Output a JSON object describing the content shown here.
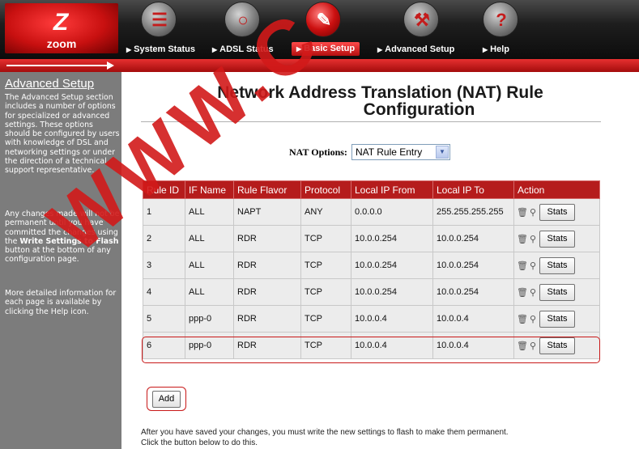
{
  "header": {
    "logo_mark": "Z",
    "logo_text": "zoom",
    "nav": [
      {
        "label": "System Status",
        "icon": "document-icon",
        "glyph": "☰"
      },
      {
        "label": "ADSL Status",
        "icon": "magnifier-icon",
        "glyph": "○"
      },
      {
        "label": "Basic Setup",
        "icon": "pencil-icon",
        "glyph": "✎"
      },
      {
        "label": "Advanced Setup",
        "icon": "wrench-icon",
        "glyph": "⚒"
      },
      {
        "label": "Help",
        "icon": "help-icon",
        "glyph": "?"
      }
    ],
    "active_nav": "Basic Setup"
  },
  "sidebar": {
    "title": "Advanced Setup",
    "para1": "The Advanced Setup section includes a number of options for specialized or advanced settings. These options should be configured by users with knowledge of DSL and networking settings or under the direction of a technical support representative.",
    "para2_a": "Any changes made will not be permanent until you have committed the changes using the ",
    "para2_bold": "Write Settings to Flash",
    "para2_b": " button at the bottom of any configuration page.",
    "para3": "More detailed information for each page is available by clicking the Help icon."
  },
  "main": {
    "title_line1": "Network Address Translation (NAT) Rule",
    "title_line2": "Configuration",
    "nat_options_label": "NAT Options:",
    "nat_options_value": "NAT Rule Entry",
    "table": {
      "headers": [
        "Rule ID",
        "IF Name",
        "Rule Flavor",
        "Protocol",
        "Local IP From",
        "Local IP To",
        "Action"
      ],
      "rows": [
        [
          "1",
          "ALL",
          "NAPT",
          "ANY",
          "0.0.0.0",
          "255.255.255.255"
        ],
        [
          "2",
          "ALL",
          "RDR",
          "TCP",
          "10.0.0.254",
          "10.0.0.254"
        ],
        [
          "3",
          "ALL",
          "RDR",
          "TCP",
          "10.0.0.254",
          "10.0.0.254"
        ],
        [
          "4",
          "ALL",
          "RDR",
          "TCP",
          "10.0.0.254",
          "10.0.0.254"
        ],
        [
          "5",
          "ppp-0",
          "RDR",
          "TCP",
          "10.0.0.4",
          "10.0.0.4"
        ],
        [
          "6",
          "ppp-0",
          "RDR",
          "TCP",
          "10.0.0.4",
          "10.0.0.4"
        ]
      ],
      "stats_label": "Stats",
      "highlighted_row": "6"
    },
    "add_label": "Add",
    "footer_line1": "After you have saved your changes, you must write the new settings to flash to make them permanent.",
    "footer_line2": "Click the button below to do this."
  },
  "watermark": "WWW.C",
  "colors": {
    "accent_red": "#b51c1c",
    "sidebar_gray": "#7c7c7c",
    "header_black": "#0c0c0c"
  }
}
